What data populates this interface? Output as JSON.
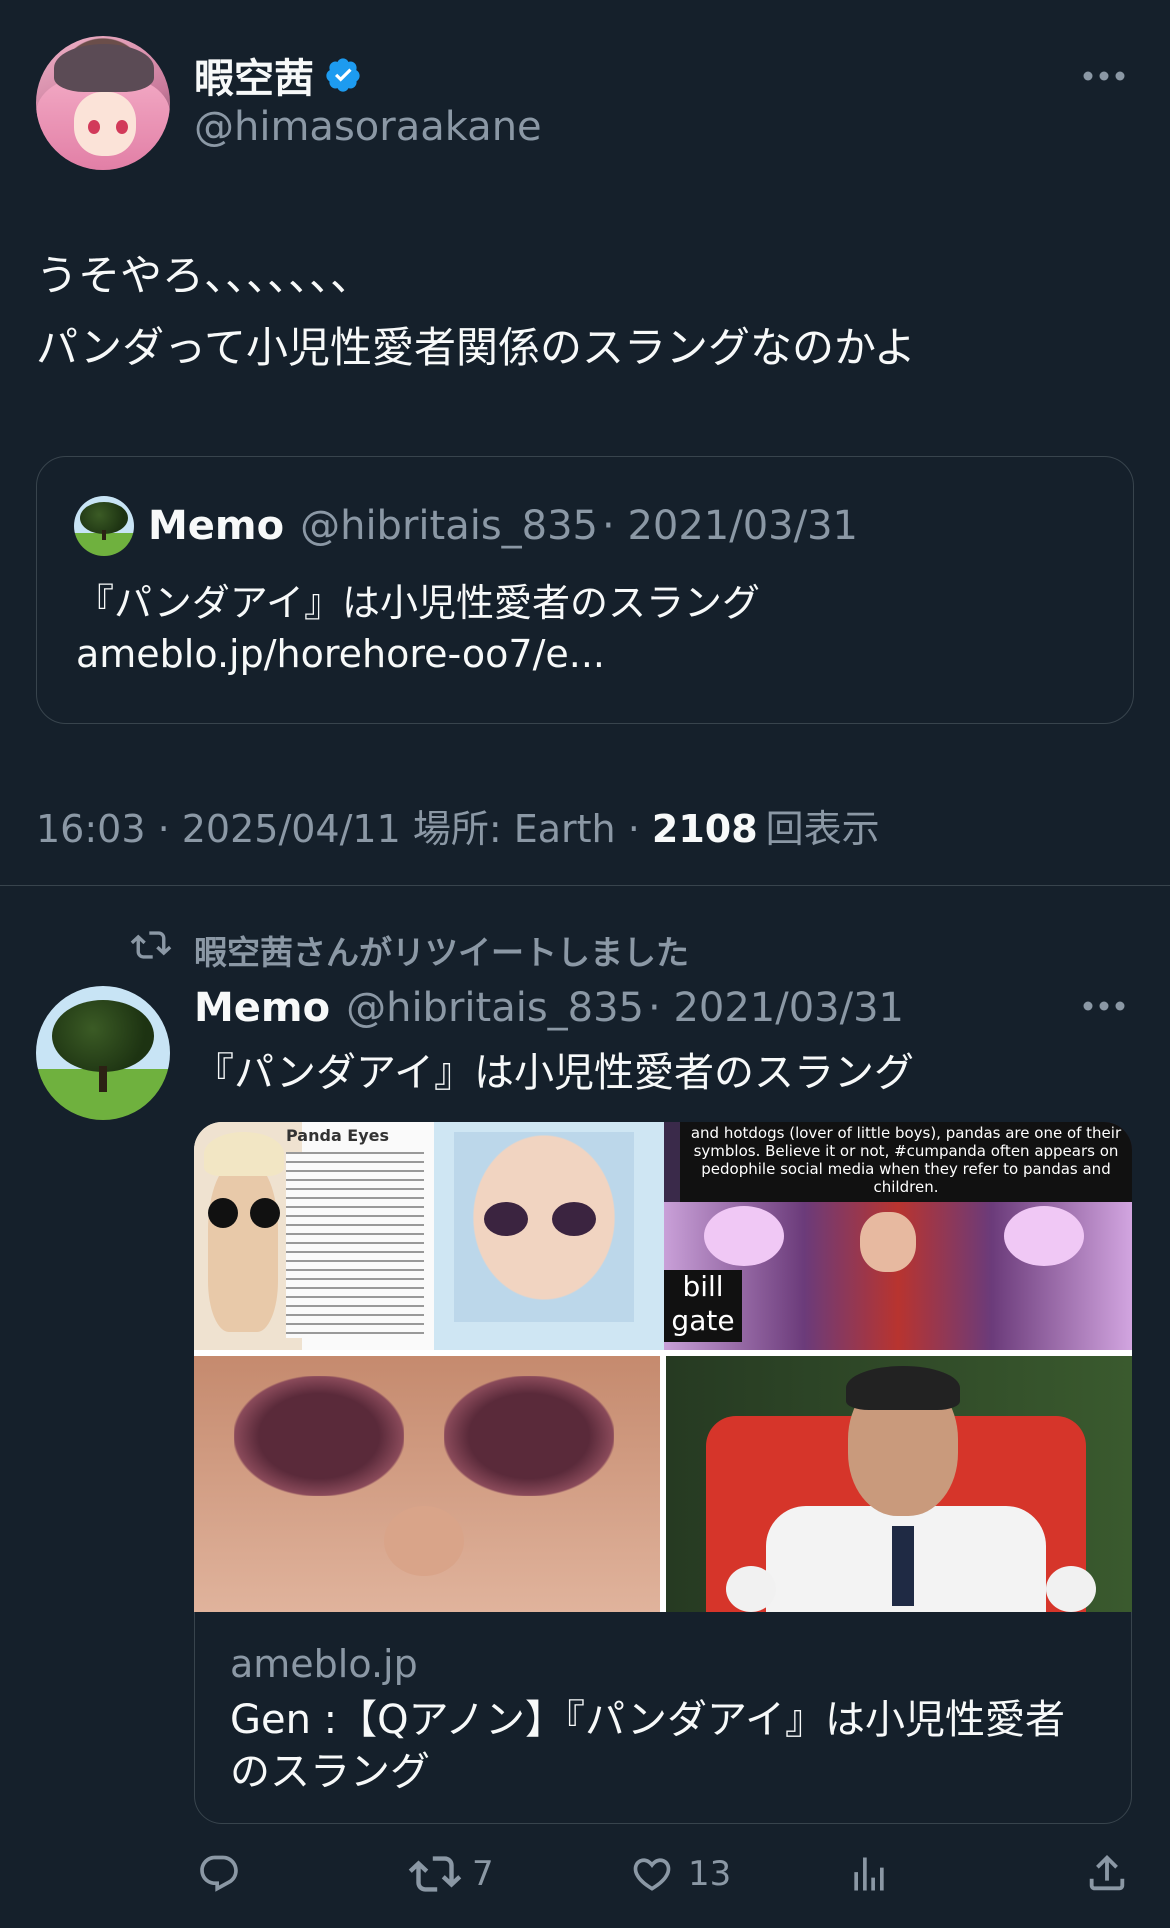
{
  "main_tweet": {
    "display_name": "暇空茜",
    "handle": "@himasoraakane",
    "text_line1": "うそやろ、、、、、、、",
    "text_line2": "パンダって小児性愛者関係のスラングなのかよ",
    "meta_time": "16:03 · 2025/04/11 場所: Earth · ",
    "view_count": "2108",
    "view_label": "回表示"
  },
  "quoted_tweet": {
    "display_name": "Memo",
    "handle": "@hibritais_835",
    "date": "· 2021/03/31",
    "text": "『パンダアイ』は小児性愛者のスラング",
    "link": "ameblo.jp/horehore-oo7/e..."
  },
  "retweet": {
    "context": "暇空茜さんがリツイートしました",
    "display_name": "Memo",
    "handle": "@hibritais_835",
    "date": "· 2021/03/31",
    "text": "『パンダアイ』は小児性愛者のスラング",
    "media": {
      "panda_eyes_title": "Panda Eyes",
      "overlay_text": "and hotdogs (lover of little boys), pandas are one of their symblos. Believe it or not, #cumpanda often appears on pedophile social media when they refer to pandas and children.",
      "caption_line1": "bill",
      "caption_line2": "gate"
    },
    "link_card": {
      "domain": "ameblo.jp",
      "title_line1": "Gen :【Qアノン】『パンダアイ』は小児性愛者",
      "title_line2": "のスラング"
    },
    "actions": {
      "retweet_count": "7",
      "like_count": "13"
    }
  },
  "colors": {
    "background": "#15202b",
    "text": "#f7f9f9",
    "muted": "#8b98a5",
    "border": "#38444d",
    "verified": "#1d9bf0"
  },
  "icons": [
    "verified-badge-icon",
    "more-icon",
    "retweet-icon",
    "reply-icon",
    "like-icon",
    "views-icon",
    "share-icon"
  ]
}
